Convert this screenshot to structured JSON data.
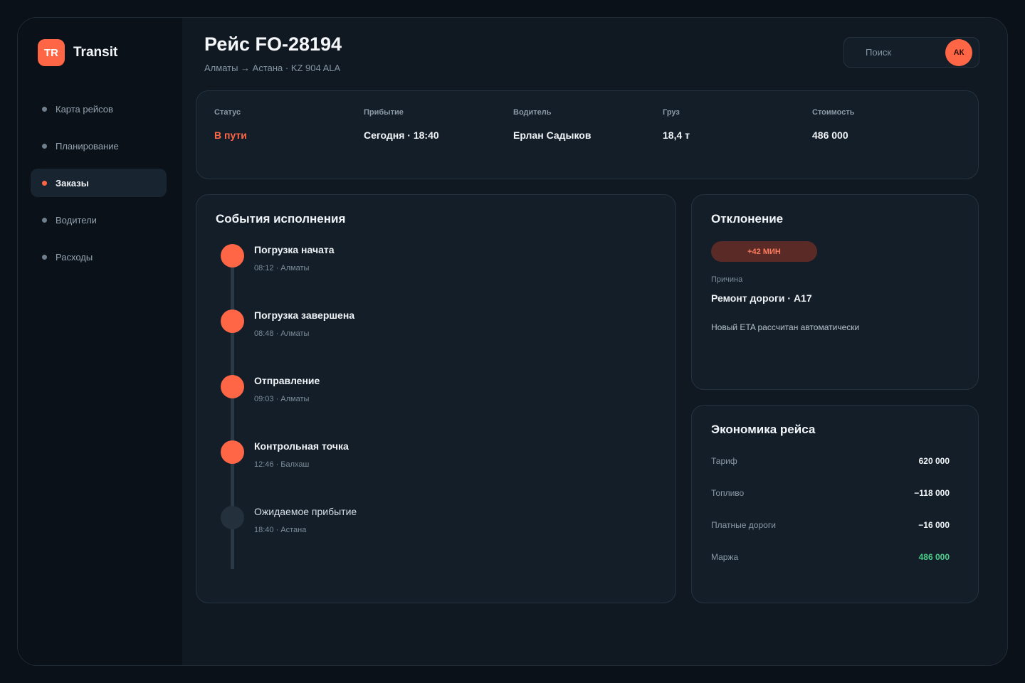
{
  "brand": {
    "logo_text": "TR",
    "name": "Transit",
    "accent_color": "#ff6645"
  },
  "sidebar": {
    "items": [
      {
        "label": "Карта рейсов",
        "active": false
      },
      {
        "label": "Планирование",
        "active": false
      },
      {
        "label": "Заказы",
        "active": true
      },
      {
        "label": "Водители",
        "active": false
      },
      {
        "label": "Расходы",
        "active": false
      }
    ]
  },
  "header": {
    "title": "Рейс FO-28194",
    "subtitle": "Алматы → Астана · KZ 904 ALA",
    "search_placeholder": "Поиск",
    "avatar_initials": "АК"
  },
  "summary": [
    {
      "label": "Статус",
      "value": "В пути"
    },
    {
      "label": "Прибытие",
      "value": "Сегодня · 18:40"
    },
    {
      "label": "Водитель",
      "value": "Ерлан Садыков"
    },
    {
      "label": "Груз",
      "value": "18,4 т"
    },
    {
      "label": "Стоимость",
      "value": "486 000"
    }
  ],
  "events": {
    "title": "События исполнения",
    "items": [
      {
        "title": "Погрузка начата",
        "meta": "08:12 · Алматы",
        "done": true
      },
      {
        "title": "Погрузка завершена",
        "meta": "08:48 · Алматы",
        "done": true
      },
      {
        "title": "Отправление",
        "meta": "09:03 · Алматы",
        "done": true
      },
      {
        "title": "Контрольная точка",
        "meta": "12:46 · Балхаш",
        "done": true
      },
      {
        "title": "Ожидаемое прибытие",
        "meta": "18:40 · Астана",
        "done": false
      }
    ]
  },
  "deviation": {
    "title": "Отклонение",
    "badge": "+42 МИН",
    "reason_label": "Причина",
    "reason": "Ремонт дороги · A17",
    "note": "Новый ETA рассчитан автоматически"
  },
  "economy": {
    "title": "Экономика рейса",
    "rows": [
      {
        "label": "Тариф",
        "value": "620 000"
      },
      {
        "label": "Топливо",
        "value": "−118 000"
      },
      {
        "label": "Платные дороги",
        "value": "−16 000"
      },
      {
        "label": "Маржа",
        "value": "486 000"
      }
    ],
    "positive_color": "#4ccf8a"
  }
}
